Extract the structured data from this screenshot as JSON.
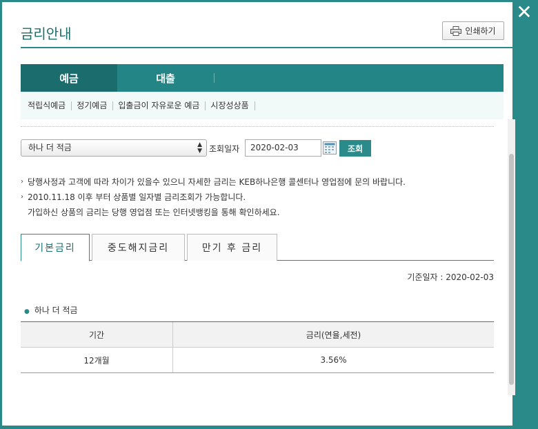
{
  "header": {
    "title": "금리안내",
    "print_label": "인쇄하기",
    "close_icon": "✕"
  },
  "main_tabs": [
    {
      "label": "예금",
      "active": true
    },
    {
      "label": "대출",
      "active": false
    }
  ],
  "sub_nav": [
    "적립식예금",
    "정기예금",
    "입출금이 자유로운 예금",
    "시장성상품"
  ],
  "query": {
    "product_select": "하나 더 적금",
    "date_label": "조회일자",
    "date_value": "2020-02-03",
    "search_label": "조회"
  },
  "notes": [
    "당행사정과 고객에 따라 차이가 있을수 있으니 자세한 금리는 KEB하나은행 콜센터나 영업점에 문의 바랍니다.",
    "2010.11.18 이후 부터 상품별 일자별 금리조회가 가능합니다.",
    "가입하신 상품의 금리는 당행 영업점 또는 인터넷뱅킹을 통해 확인하세요."
  ],
  "rate_tabs": [
    {
      "label": "기본금리",
      "active": true
    },
    {
      "label": "중도해지금리",
      "active": false
    },
    {
      "label": "만기 후 금리",
      "active": false
    }
  ],
  "base_date": "기준일자 : 2020-02-03",
  "product_name": "하나 더 적금",
  "table": {
    "headers": [
      "기간",
      "금리(연율,세전)"
    ],
    "rows": [
      [
        "12개월",
        "3.56%"
      ]
    ]
  },
  "colors": {
    "accent": "#2a8a8a",
    "tab_active": "#1b6c6d"
  }
}
